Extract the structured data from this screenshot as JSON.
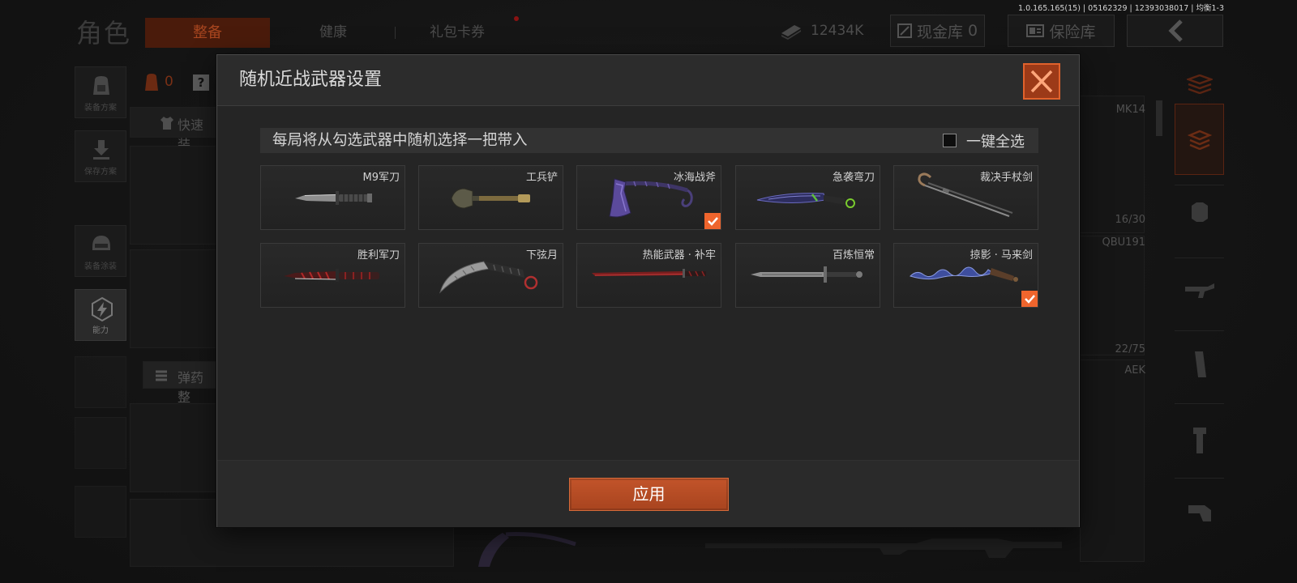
{
  "background": {
    "section_title": "角色",
    "tabs": [
      {
        "label": "整备",
        "active": true
      },
      {
        "label": "健康",
        "active": false
      },
      {
        "label": "礼包卡券",
        "active": false,
        "has_notification": true
      }
    ],
    "build_info": "1.0.165.165(15) | 05162329 | 12393038017 | 均衡1-3",
    "currency": {
      "icon": "cash-stack-icon",
      "amount": "12434K"
    },
    "cash_vault": {
      "icon": "cash-vault-icon",
      "label": "现金库",
      "value": "0"
    },
    "safe_vault": {
      "icon": "safe-icon",
      "label": "保险库"
    },
    "back_button": {
      "icon": "chevron-left-icon"
    },
    "sidebar": [
      {
        "icon": "backpack-icon",
        "label": "装备方案"
      },
      {
        "icon": "download-icon",
        "label": "保存方案"
      },
      {
        "icon": "helmet-icon",
        "label": "装备涂装"
      },
      {
        "icon": "lightning-icon",
        "label": "能力",
        "active": true
      }
    ],
    "loadout": {
      "armor_count": "0",
      "help": "?",
      "quick_equip": "快速装",
      "ammo": "弹药整"
    },
    "weapon_slots": [
      {
        "name": "MK14",
        "ammo": "16/30"
      },
      {
        "name": "QBU191",
        "ammo": "22/75"
      },
      {
        "name": "AEK"
      }
    ]
  },
  "modal": {
    "title": "随机近战武器设置",
    "description": "每局将从勾选武器中随机选择一把带入",
    "select_all": {
      "label": "一键全选",
      "checked": false
    },
    "weapons": [
      {
        "name": "M9军刀",
        "icon": "bayonet-icon",
        "checked": false
      },
      {
        "name": "工兵铲",
        "icon": "shovel-icon",
        "checked": false
      },
      {
        "name": "冰海战斧",
        "icon": "axe-icon",
        "checked": true
      },
      {
        "name": "急袭弯刀",
        "icon": "curved-blade-icon",
        "checked": false
      },
      {
        "name": "裁决手杖剑",
        "icon": "cane-sword-icon",
        "checked": false
      },
      {
        "name": "胜利军刀",
        "icon": "combat-knife-icon",
        "checked": false
      },
      {
        "name": "下弦月",
        "icon": "karambit-icon",
        "checked": false
      },
      {
        "name": "热能武器 · 补牢",
        "icon": "katana-icon",
        "checked": false
      },
      {
        "name": "百炼恒常",
        "icon": "longsword-icon",
        "checked": false
      },
      {
        "name": "掠影 · 马来剑",
        "icon": "kris-icon",
        "checked": true
      }
    ],
    "close_icon": "close-icon",
    "apply_label": "应用"
  },
  "colors": {
    "accent": "#e9622a",
    "check": "#ef652d",
    "apply_button": "#b44a22",
    "modal_bg": "#252525"
  }
}
